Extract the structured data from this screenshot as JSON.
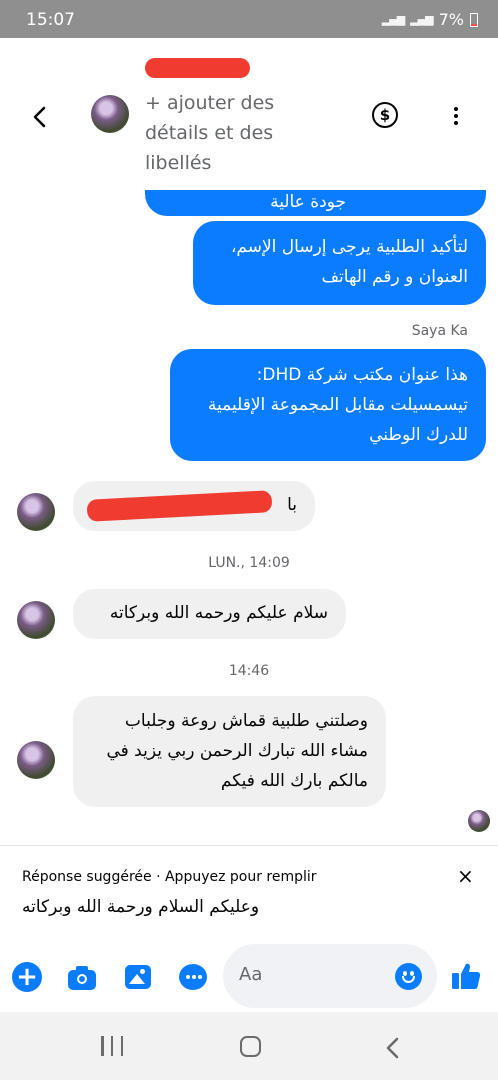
{
  "status_bar": {
    "time": "15:07",
    "battery": "7%"
  },
  "header": {
    "add_details": "+ ajouter des détails et des libellés",
    "dollar_symbol": "$",
    "icons": [
      "back-arrow-icon",
      "dollar-icon",
      "more-options-icon"
    ]
  },
  "messages": {
    "partial_top": "جودة عالية",
    "outgoing_1": "لتأكيد الطلبية يرجى إرسال الإسم، العنوان و رقم الهاتف",
    "sender_name": "Saya Ka",
    "outgoing_2": "هذا عنوان مكتب شركة DHD: تيسمسيلت مقابل المجموعة الإقليمية للدرك الوطني",
    "incoming_redacted_prefix": "با",
    "timestamp_1": "LUN., 14:09",
    "incoming_1": "سلام عليكم ورحمه الله وبركاته",
    "timestamp_2": "14:46",
    "incoming_2": "وصلتني طلبية قماش روعة وجلباب مشاء الله تبارك الرحمن ربي يزيد في مالكم بارك الله فيكم"
  },
  "suggestion": {
    "label": "Réponse suggérée · Appuyez pour remplir",
    "close": "×",
    "text": "وعليكم السلام ورحمة الله وبركاته"
  },
  "composer": {
    "plus": "+",
    "placeholder": "Aa",
    "icons": [
      "plus-icon",
      "camera-icon",
      "photo-icon",
      "chat-dots-icon",
      "emoji-icon",
      "like-icon"
    ]
  },
  "colors": {
    "accent": "#0a7cff",
    "incoming_bg": "#f0f0f0",
    "redaction": "#ef3b30"
  }
}
